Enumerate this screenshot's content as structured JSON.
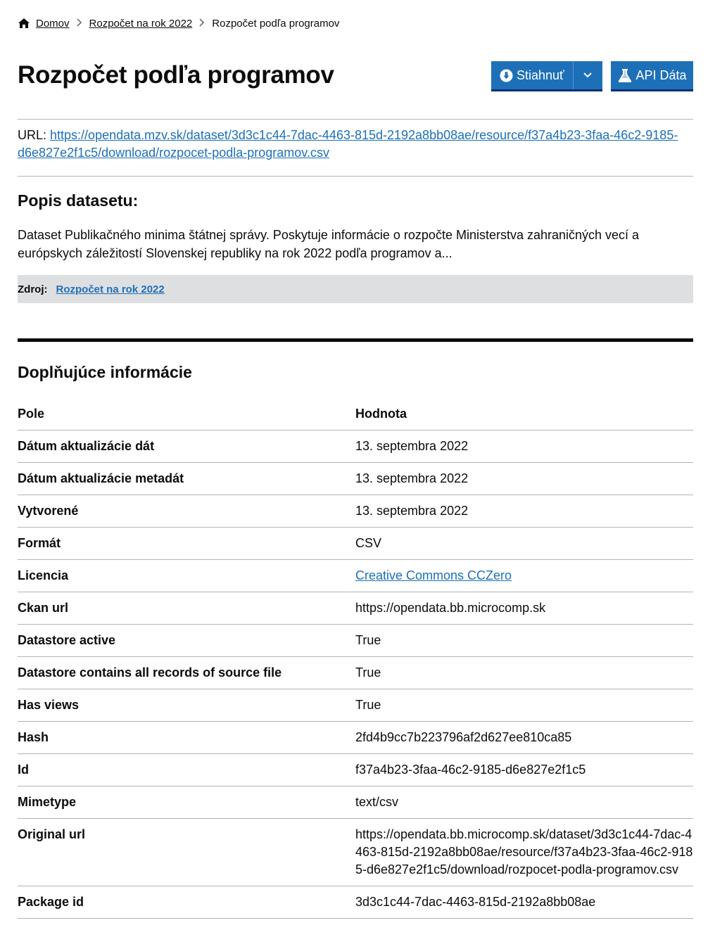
{
  "breadcrumb": {
    "home": "Domov",
    "parent": "Rozpočet na rok 2022",
    "current": "Rozpočet podľa programov"
  },
  "title": "Rozpočet podľa programov",
  "buttons": {
    "download": "Stiahnuť",
    "api": "API Dáta"
  },
  "url": {
    "label": "URL:",
    "link": "https://opendata.mzv.sk/dataset/3d3c1c44-7dac-4463-815d-2192a8bb08ae/resource/f37a4b23-3faa-46c2-9185-d6e827e2f1c5/download/rozpocet-podla-programov.csv"
  },
  "description": {
    "heading": "Popis datasetu:",
    "text": "Dataset Publikačného minima štátnej správy. Poskytuje informácie o rozpočte Ministerstva zahraničných vecí a európskych záležitostí Slovenskej republiky na rok 2022 podľa programov a..."
  },
  "source": {
    "label": "Zdroj:",
    "link": "Rozpočet na rok 2022"
  },
  "additional": {
    "heading": "Doplňujúce informácie",
    "col_field": "Pole",
    "col_value": "Hodnota",
    "rows": [
      {
        "field": "Dátum aktualizácie dát",
        "value": "13. septembra 2022"
      },
      {
        "field": "Dátum aktualizácie metadát",
        "value": "13. septembra 2022"
      },
      {
        "field": "Vytvorené",
        "value": "13. septembra 2022"
      },
      {
        "field": "Formát",
        "value": "CSV"
      },
      {
        "field": "Licencia",
        "value": "Creative Commons CCZero"
      },
      {
        "field": "Ckan url",
        "value": "https://opendata.bb.microcomp.sk"
      },
      {
        "field": "Datastore active",
        "value": "True"
      },
      {
        "field": "Datastore contains all records of source file",
        "value": "True"
      },
      {
        "field": "Has views",
        "value": "True"
      },
      {
        "field": "Hash",
        "value": "2fd4b9cc7b223796af2d627ee810ca85"
      },
      {
        "field": "Id",
        "value": "f37a4b23-3faa-46c2-9185-d6e827e2f1c5"
      },
      {
        "field": "Mimetype",
        "value": "text/csv"
      },
      {
        "field": "Original url",
        "value": "https://opendata.bb.microcomp.sk/dataset/3d3c1c44-7dac-4463-815d-2192a8bb08ae/resource/f37a4b23-3faa-46c2-9185-d6e827e2f1c5/download/rozpocet-podla-programov.csv"
      },
      {
        "field": "Package id",
        "value": "3d3c1c44-7dac-4463-815d-2192a8bb08ae"
      }
    ]
  }
}
